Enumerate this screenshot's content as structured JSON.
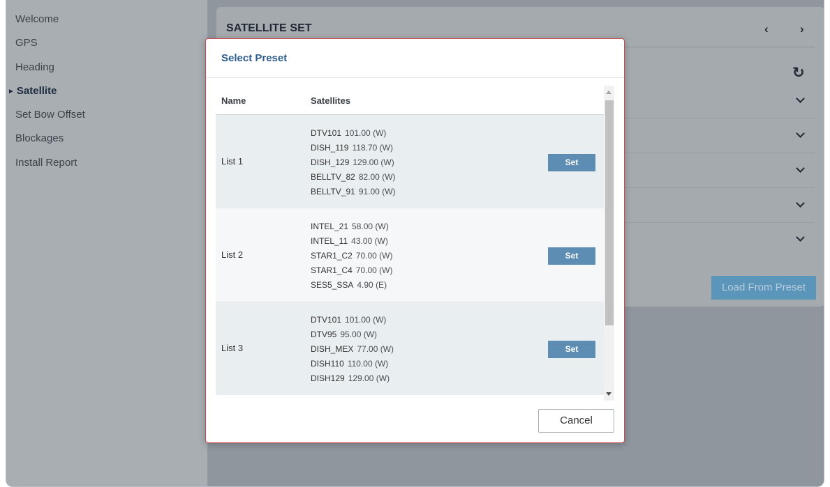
{
  "sidebar": {
    "items": [
      {
        "label": "Welcome"
      },
      {
        "label": "GPS"
      },
      {
        "label": "Heading"
      },
      {
        "label": "Satellite",
        "marker": "►"
      },
      {
        "label": "Set Bow Offset"
      },
      {
        "label": "Blockages"
      },
      {
        "label": "Install Report"
      }
    ]
  },
  "main": {
    "title": "SATELLITE SET",
    "prev_icon": "‹",
    "next_icon": "›",
    "refresh_icon": "↻",
    "load_preset_label": "Load From Preset"
  },
  "modal": {
    "title": "Select Preset",
    "columns": {
      "name": "Name",
      "satellites": "Satellites"
    },
    "set_label": "Set",
    "cancel_label": "Cancel",
    "rows": [
      {
        "name": "List 1",
        "satellites": [
          {
            "name": "DTV101",
            "position": "101.00 (W)"
          },
          {
            "name": "DISH_119",
            "position": "118.70 (W)"
          },
          {
            "name": "DISH_129",
            "position": "129.00 (W)"
          },
          {
            "name": "BELLTV_82",
            "position": "82.00 (W)"
          },
          {
            "name": "BELLTV_91",
            "position": "91.00 (W)"
          }
        ]
      },
      {
        "name": "List 2",
        "satellites": [
          {
            "name": "INTEL_21",
            "position": "58.00 (W)"
          },
          {
            "name": "INTEL_11",
            "position": "43.00 (W)"
          },
          {
            "name": "STAR1_C2",
            "position": "70.00 (W)"
          },
          {
            "name": "STAR1_C4",
            "position": "70.00 (W)"
          },
          {
            "name": "SES5_SSA",
            "position": "4.90 (E)"
          }
        ]
      },
      {
        "name": "List 3",
        "satellites": [
          {
            "name": "DTV101",
            "position": "101.00 (W)"
          },
          {
            "name": "DTV95",
            "position": "95.00 (W)"
          },
          {
            "name": "DISH_MEX",
            "position": "77.00 (W)"
          },
          {
            "name": "DISH110",
            "position": "110.00 (W)"
          },
          {
            "name": "DISH129",
            "position": "129.00 (W)"
          }
        ]
      }
    ]
  }
}
